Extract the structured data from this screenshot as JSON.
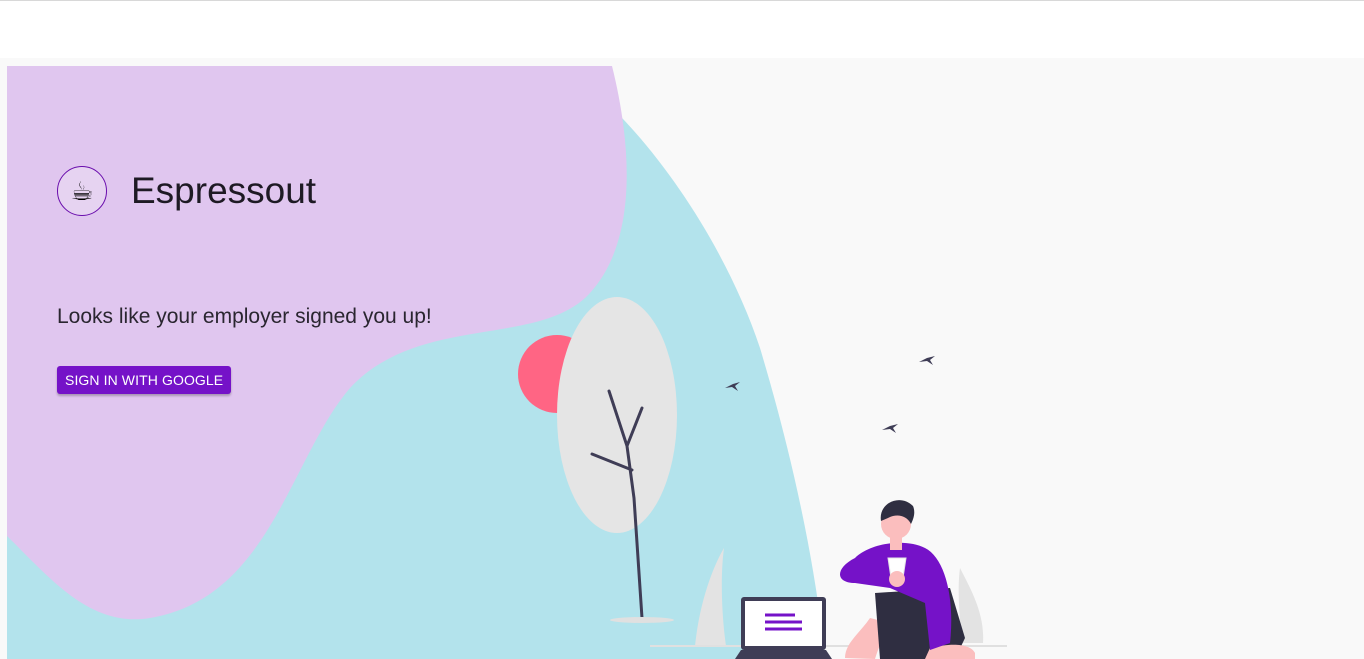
{
  "brand": {
    "logo_glyph": "☕",
    "name": "Espressout"
  },
  "main": {
    "tagline": "Looks like your employer signed you up!",
    "signin_label": "SIGN IN WITH GOOGLE"
  },
  "colors": {
    "primary": "#7512c8",
    "lilac": "#e0c6ef",
    "teal": "#b3e3ec",
    "pink": "#ff6584",
    "background": "#f9f9f9"
  },
  "illustration": {
    "icons": [
      "tree-icon",
      "sun-icon",
      "bird-icon",
      "laptop-icon",
      "person-icon",
      "coffee-cup-icon"
    ]
  }
}
